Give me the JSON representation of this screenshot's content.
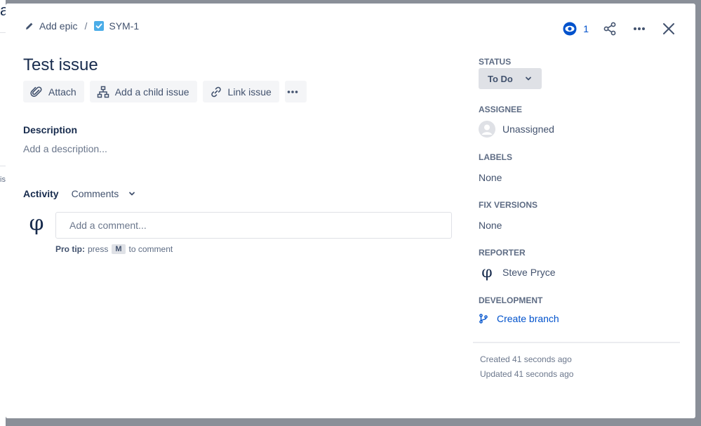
{
  "background": {
    "glyph_top": "a",
    "glyph_mid": "is"
  },
  "breadcrumb": {
    "epic_label": "Add epic",
    "separator": "/",
    "issue_key": "SYM-1"
  },
  "header": {
    "watchers_count": "1"
  },
  "issue": {
    "title": "Test issue",
    "actions": {
      "attach": "Attach",
      "add_child": "Add a child issue",
      "link_issue": "Link issue"
    },
    "description_label": "Description",
    "description_placeholder": "Add a description...",
    "activity": {
      "label": "Activity",
      "filter": "Comments",
      "comment_placeholder": "Add a comment...",
      "user_avatar_glyph": "φ",
      "pro_tip_label": "Pro tip:",
      "pro_tip_press": "press",
      "pro_tip_key": "M",
      "pro_tip_suffix": "to comment"
    }
  },
  "sidebar": {
    "status": {
      "label": "STATUS",
      "value": "To Do"
    },
    "assignee": {
      "label": "ASSIGNEE",
      "value": "Unassigned"
    },
    "labels": {
      "label": "LABELS",
      "value": "None"
    },
    "fix_versions": {
      "label": "FIX VERSIONS",
      "value": "None"
    },
    "reporter": {
      "label": "REPORTER",
      "value": "Steve Pryce",
      "avatar_glyph": "φ"
    },
    "development": {
      "label": "DEVELOPMENT",
      "value": "Create branch"
    },
    "created": "Created 41 seconds ago",
    "updated": "Updated 41 seconds ago"
  },
  "colors": {
    "accent": "#0052cc",
    "text": "#172b4d",
    "subtle": "#42526e",
    "button_bg": "#f4f5f7",
    "status_bg": "#dfe1e6",
    "overlay": "#8a8f98"
  }
}
